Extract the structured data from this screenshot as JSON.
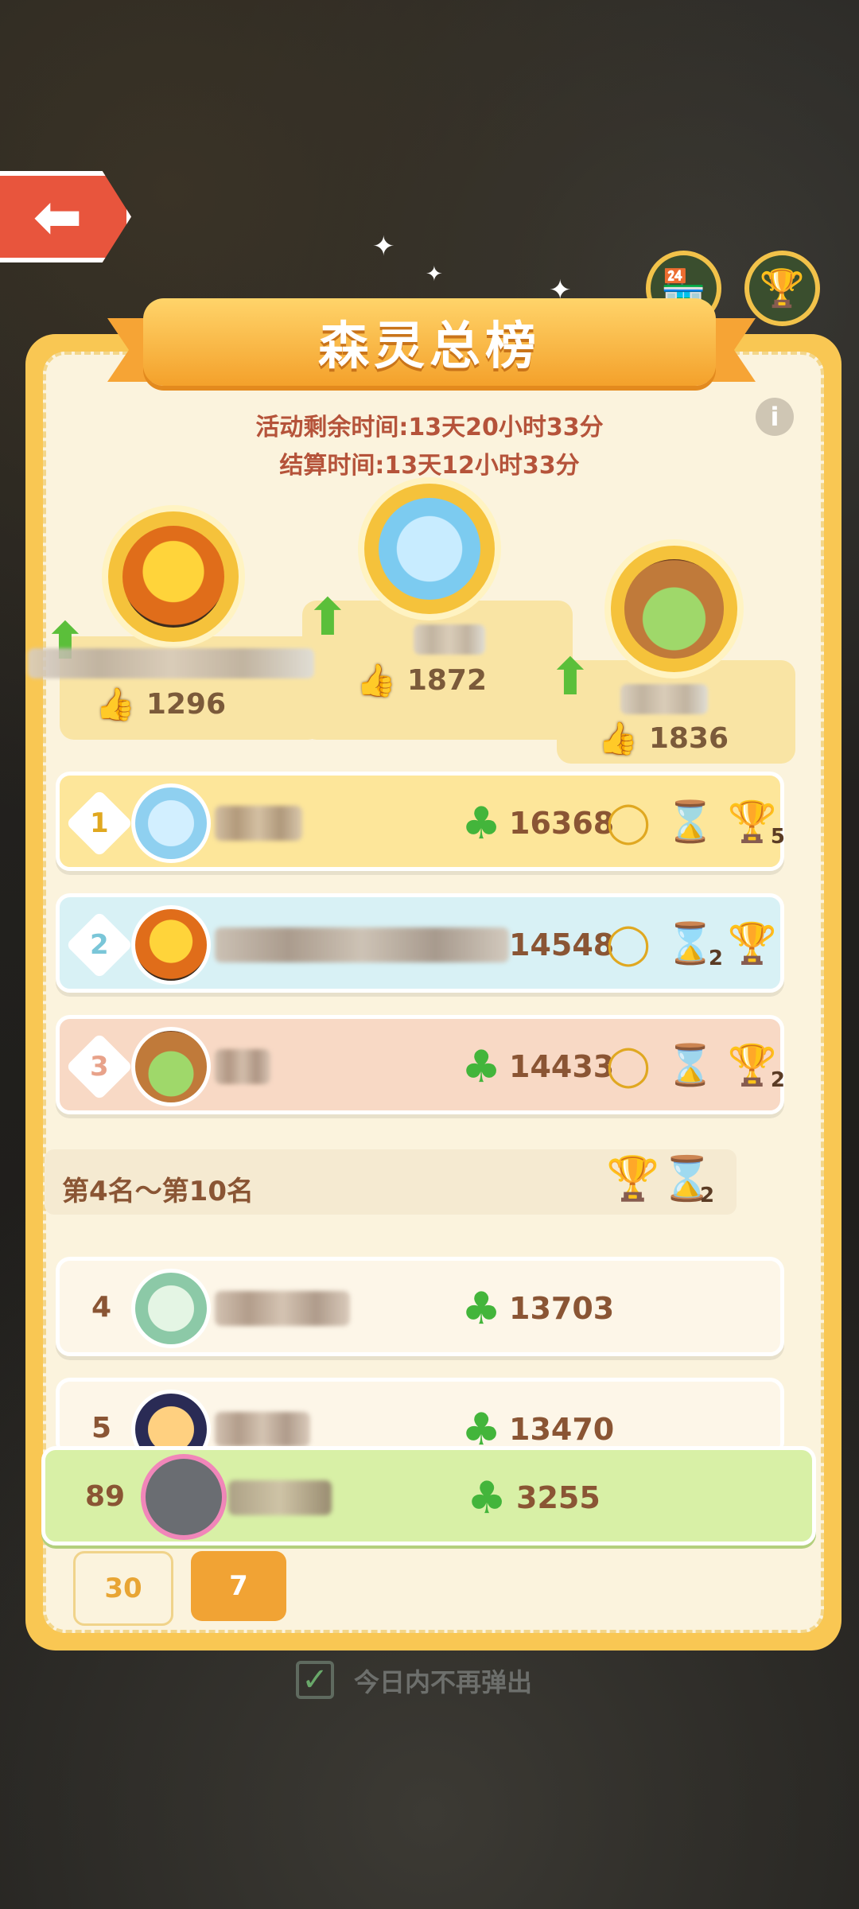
{
  "title": "森灵总榜",
  "timers": {
    "remaining": "活动剩余时间:13天20小时33分",
    "settlement": "结算时间:13天12小时33分"
  },
  "podium": [
    {
      "place": 2,
      "likes": "1296"
    },
    {
      "place": 1,
      "likes": "1872"
    },
    {
      "place": 3,
      "likes": "1836"
    }
  ],
  "top_rows": [
    {
      "rank": "1",
      "score": "16368",
      "reward_count": "5"
    },
    {
      "rank": "2",
      "score": "14548",
      "reward_count": "2"
    },
    {
      "rank": "3",
      "score": "14433",
      "reward_count": "2"
    }
  ],
  "section": {
    "title": "第4名～第10名",
    "reward_count": "2"
  },
  "rows": [
    {
      "rank": "4",
      "score": "13703"
    },
    {
      "rank": "5",
      "score": "13470"
    }
  ],
  "self": {
    "rank": "89",
    "score": "3255"
  },
  "tabs": {
    "t30": "30",
    "t7": "7"
  },
  "footer": {
    "checkbox_label": "今日内不再弹出"
  },
  "icons": {
    "back": "back-arrow-icon",
    "shop": "shop-icon",
    "trophy": "trophy-icon",
    "info": "info-icon",
    "clover": "clover-icon",
    "thumb": "thumbs-up-icon"
  }
}
